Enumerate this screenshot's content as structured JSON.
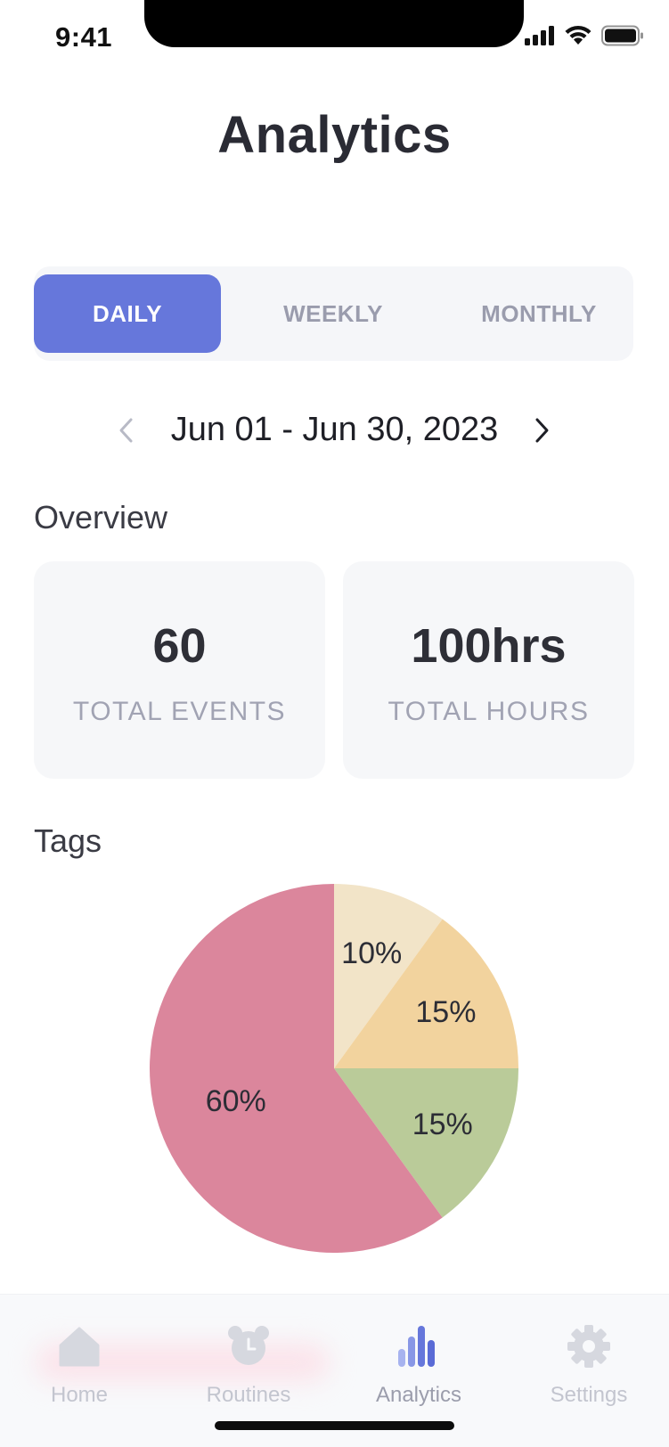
{
  "status_bar": {
    "time": "9:41"
  },
  "header": {
    "title": "Analytics"
  },
  "period_tabs": [
    {
      "label": "DAILY",
      "active": true
    },
    {
      "label": "WEEKLY",
      "active": false
    },
    {
      "label": "MONTHLY",
      "active": false
    }
  ],
  "date_range": {
    "label": "Jun 01 - Jun 30, 2023",
    "prev_icon": "chevron-left-icon",
    "next_icon": "chevron-right-icon"
  },
  "overview": {
    "title": "Overview",
    "cards": [
      {
        "value": "60",
        "label": "TOTAL EVENTS"
      },
      {
        "value": "100hrs",
        "label": "TOTAL HOURS"
      }
    ]
  },
  "tags": {
    "title": "Tags"
  },
  "chart_data": {
    "type": "pie",
    "slices": [
      {
        "label": "10%",
        "value": 10,
        "color": "#f2e4c8"
      },
      {
        "label": "15%",
        "value": 15,
        "color": "#f2d39e"
      },
      {
        "label": "15%",
        "value": 15,
        "color": "#bacb99"
      },
      {
        "label": "60%",
        "value": 60,
        "color": "#db869c"
      }
    ],
    "start": "12 o'clock",
    "direction": "clockwise"
  },
  "tab_bar": {
    "items": [
      {
        "label": "Home",
        "icon": "home-icon",
        "active": false
      },
      {
        "label": "Routines",
        "icon": "alarm-clock-icon",
        "active": false
      },
      {
        "label": "Analytics",
        "icon": "bar-chart-icon",
        "active": true
      },
      {
        "label": "Settings",
        "icon": "gear-icon",
        "active": false
      }
    ]
  },
  "colors": {
    "accent": "#6677db",
    "card_background": "#f6f7f9",
    "inactive_tab": "#9a9cad"
  }
}
